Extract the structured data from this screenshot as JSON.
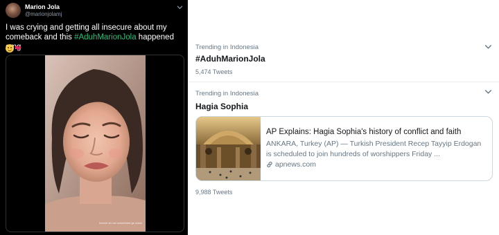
{
  "tweet": {
    "author_name": "Marion Jola",
    "author_handle": "@marionjolamj",
    "text_before": "I was crying and getting all insecure about my comeback and this ",
    "hashtag": "#AduhMarionJola",
    "text_after": " happened omg",
    "video_caption": "hmmm vlo we scenetmed ge ndam",
    "colors": {
      "background": "#000000",
      "hashtag": "#27c07d"
    }
  },
  "trends": [
    {
      "context": "Trending in Indonesia",
      "name": "#AduhMarionJola",
      "count": "5,474 Tweets"
    },
    {
      "context": "Trending in Indonesia",
      "name": "Hagia Sophia",
      "count": "9,988 Tweets",
      "card": {
        "title": "AP Explains: Hagia Sophia's history of conflict and faith",
        "description": "ANKARA, Turkey (AP) — Turkish President Recep Tayyip Erdogan is scheduled to join hundreds of worshippers Friday ...",
        "domain": "apnews.com"
      }
    }
  ]
}
